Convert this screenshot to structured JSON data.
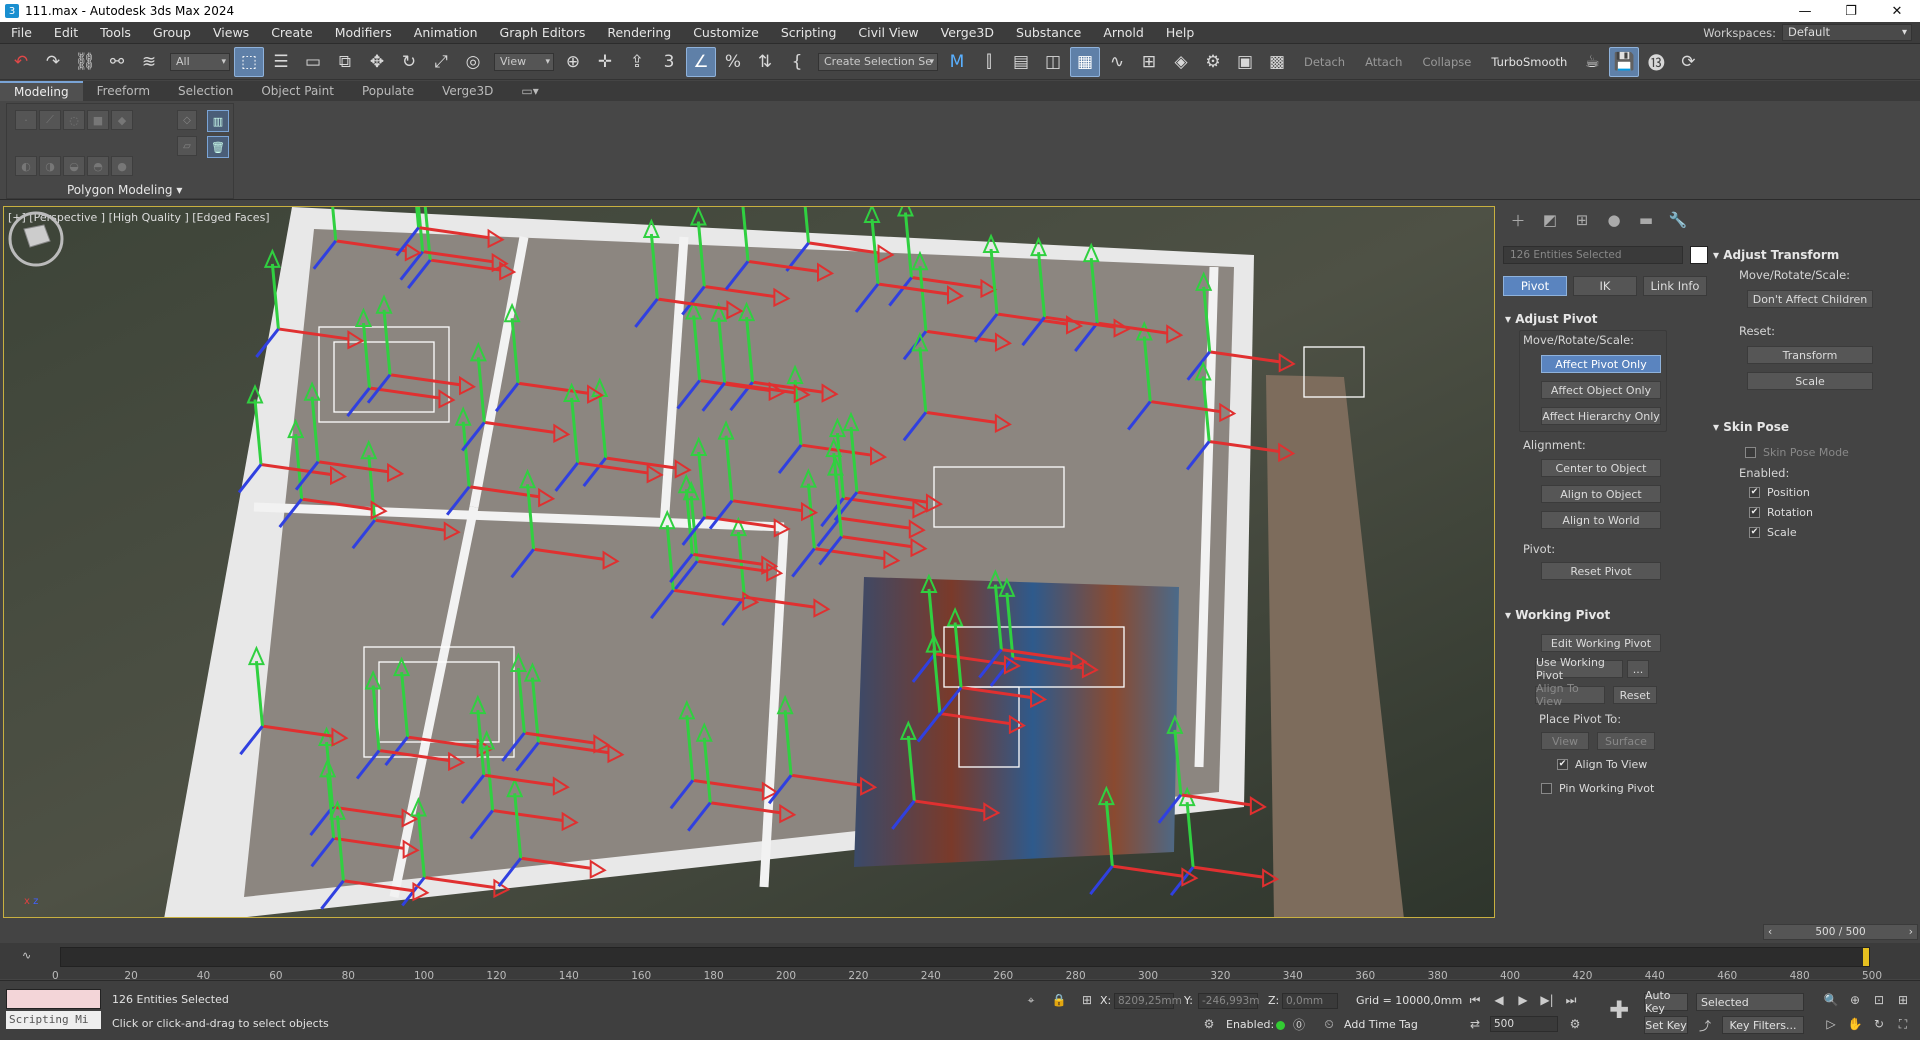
{
  "window": {
    "title": "111.max - Autodesk 3ds Max 2024",
    "app_icon": "3"
  },
  "menu": [
    "File",
    "Edit",
    "Tools",
    "Group",
    "Views",
    "Create",
    "Modifiers",
    "Animation",
    "Graph Editors",
    "Rendering",
    "Customize",
    "Scripting",
    "Civil View",
    "Verge3D",
    "Substance",
    "Arnold",
    "Help"
  ],
  "workspace": {
    "label": "Workspaces:",
    "value": "Default"
  },
  "toolbar": {
    "filter": "All",
    "view": "View",
    "create_selection": "Create Selection Se",
    "detach": "Detach",
    "attach": "Attach",
    "collapse": "Collapse",
    "turbosmooth": "TurboSmooth"
  },
  "ribbon_tabs": [
    "Modeling",
    "Freeform",
    "Selection",
    "Object Paint",
    "Populate",
    "Verge3D"
  ],
  "ribbon": {
    "polygon_modeling": "Polygon Modeling"
  },
  "viewport": {
    "label": "[+] [Perspective ] [High Quality ] [Edged Faces]"
  },
  "command_panel": {
    "selection_field": "126 Entities Selected",
    "tabs": [
      "Pivot",
      "IK",
      "Link Info"
    ],
    "adjust_pivot": {
      "title": "Adjust Pivot",
      "move_label": "Move/Rotate/Scale:",
      "affect_pivot_only": "Affect Pivot Only",
      "affect_object_only": "Affect Object Only",
      "affect_hierarchy_only": "Affect Hierarchy Only",
      "alignment_label": "Alignment:",
      "center_to_object": "Center to Object",
      "align_to_object": "Align to Object",
      "align_to_world": "Align to World",
      "pivot_label": "Pivot:",
      "reset_pivot": "Reset Pivot"
    },
    "working_pivot": {
      "title": "Working Pivot",
      "edit_working_pivot": "Edit Working Pivot",
      "use_working_pivot": "Use Working Pivot",
      "ellipsis": "...",
      "align_to_view": "Align To View",
      "reset": "Reset",
      "place_label": "Place Pivot To:",
      "view": "View",
      "surface": "Surface",
      "align_to_view_chk": "Align To View",
      "pin_working_pivot": "Pin Working Pivot"
    },
    "adjust_transform": {
      "title": "Adjust Transform",
      "move_label": "Move/Rotate/Scale:",
      "dont_affect_children": "Don't Affect Children",
      "reset_label": "Reset:",
      "transform": "Transform",
      "scale": "Scale"
    },
    "skin_pose": {
      "title": "Skin Pose",
      "skin_pose_mode": "Skin Pose Mode",
      "enabled_label": "Enabled:",
      "position": "Position",
      "rotation": "Rotation",
      "scale": "Scale"
    }
  },
  "timeline": {
    "frame_display": "500 / 500",
    "ticks": [
      "0",
      "20",
      "40",
      "60",
      "80",
      "100",
      "120",
      "140",
      "160",
      "180",
      "200",
      "220",
      "240",
      "260",
      "280",
      "300",
      "320",
      "340",
      "360",
      "380",
      "400",
      "420",
      "440",
      "460",
      "480",
      "500"
    ],
    "current_frame_fraction": 1.0
  },
  "status": {
    "maxscript_label": "Scripting Mi",
    "selected": "126 Entities Selected",
    "prompt": "Click or click-and-drag to select objects",
    "x_label": "X:",
    "x_value": "8209,25mm",
    "y_label": "Y:",
    "y_value": "-246,993m",
    "z_label": "Z:",
    "z_value": "0,0mm",
    "grid": "Grid = 10000,0mm",
    "enabled_label": "Enabled:",
    "add_time_tag": "Add Time Tag",
    "auto_key": "Auto Key",
    "set_key": "Set Key",
    "selected_dd": "Selected",
    "key_filters": "Key Filters...",
    "frame_field": "500"
  },
  "colors": {
    "accent": "#5a84bf",
    "viewport_border": "#c8b040",
    "gizmo_x": "#e03030",
    "gizmo_y": "#30d040",
    "gizmo_z": "#3040e0"
  }
}
